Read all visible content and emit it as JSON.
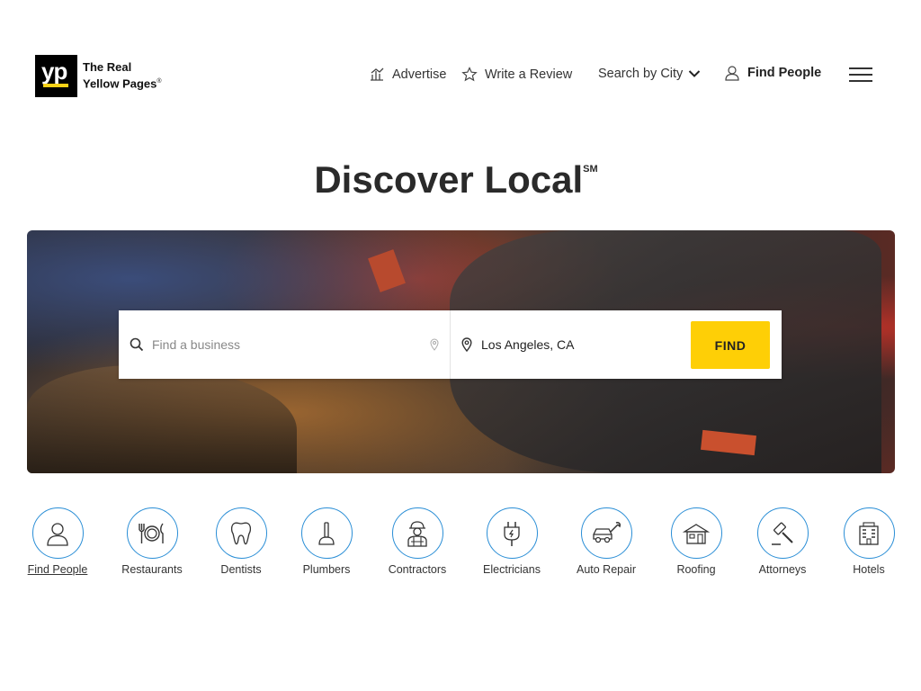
{
  "header": {
    "logo_mark": "yp",
    "logo_line1": "The Real",
    "logo_line2": "Yellow Pages",
    "logo_reg": "®",
    "nav": {
      "advertise": "Advertise",
      "write_review": "Write a Review",
      "search_by_city": "Search by City",
      "find_people": "Find People"
    }
  },
  "hero": {
    "title": "Discover Local",
    "title_mark": "SM",
    "search": {
      "what_placeholder": "Find a business",
      "where_value": "Los Angeles, CA",
      "find_label": "FIND"
    }
  },
  "categories": [
    {
      "label": "Find People",
      "icon": "person-icon"
    },
    {
      "label": "Restaurants",
      "icon": "restaurant-icon"
    },
    {
      "label": "Dentists",
      "icon": "tooth-icon"
    },
    {
      "label": "Plumbers",
      "icon": "plunger-icon"
    },
    {
      "label": "Contractors",
      "icon": "worker-icon"
    },
    {
      "label": "Electricians",
      "icon": "plug-icon"
    },
    {
      "label": "Auto Repair",
      "icon": "car-wrench-icon"
    },
    {
      "label": "Roofing",
      "icon": "house-icon"
    },
    {
      "label": "Attorneys",
      "icon": "gavel-icon"
    },
    {
      "label": "Hotels",
      "icon": "hotel-icon"
    }
  ],
  "colors": {
    "accent_yellow": "#fecf06",
    "icon_ring_blue": "#2a8ed6"
  }
}
